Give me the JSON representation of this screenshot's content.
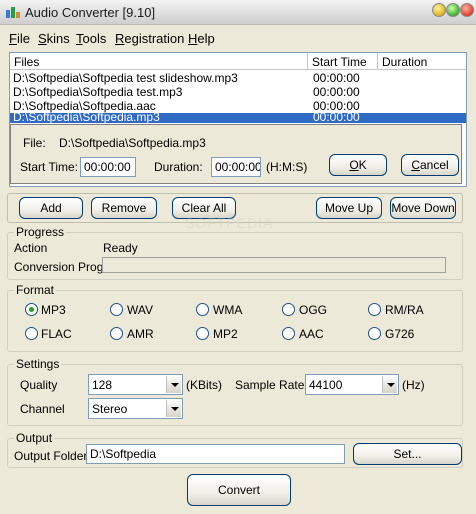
{
  "window": {
    "title": "Audio Converter [9.10]"
  },
  "menu": [
    {
      "accel": "F",
      "rest": "ile"
    },
    {
      "accel": "S",
      "rest": "kins"
    },
    {
      "accel": "T",
      "rest": "ools"
    },
    {
      "accel": "R",
      "rest": "egistration"
    },
    {
      "accel": "H",
      "rest": "elp"
    }
  ],
  "file_list": {
    "columns": [
      "Files",
      "Start Time",
      "Duration"
    ],
    "rows": [
      {
        "file": "D:\\Softpedia\\Softpedia test slideshow.mp3",
        "start": "00:00:00",
        "duration": ""
      },
      {
        "file": "D:\\Softpedia\\Softpedia test.mp3",
        "start": "00:00:00",
        "duration": ""
      },
      {
        "file": "D:\\Softpedia\\Softpedia.aac",
        "start": "00:00:00",
        "duration": ""
      },
      {
        "file": "D:\\Softpedia\\Softpedia.mp3",
        "start": "00:00:00",
        "duration": ""
      }
    ]
  },
  "editor": {
    "file_label": "File:",
    "file_value": "D:\\Softpedia\\Softpedia.mp3",
    "start_label": "Start Time:",
    "start_value": "00:00:00",
    "duration_label": "Duration:",
    "duration_value": "00:00:00",
    "hms_hint": "(H:M:S)",
    "ok_accel": "O",
    "ok_rest": "K",
    "cancel_accel": "C",
    "cancel_rest": "ancel"
  },
  "toolbar": {
    "add": "Add",
    "remove": "Remove",
    "clear_all": "Clear All",
    "move_up": "Move Up",
    "move_down": "Move Down"
  },
  "watermark": "SOFTPEDIA",
  "progress": {
    "title": "Progress",
    "action_label": "Action",
    "action_value": "Ready",
    "conversion_label": "Conversion Progr",
    "value_percent": 0
  },
  "format": {
    "title": "Format",
    "options": [
      "MP3",
      "WAV",
      "WMA",
      "OGG",
      "RM/RA",
      "FLAC",
      "AMR",
      "MP2",
      "AAC",
      "G726"
    ],
    "selected": "MP3"
  },
  "settings": {
    "title": "Settings",
    "quality_label": "Quality",
    "quality_value": "128",
    "quality_unit": "(KBits)",
    "sample_rate_label": "Sample Rate",
    "sample_rate_value": "44100",
    "sample_rate_unit": "(Hz)",
    "channel_label": "Channel",
    "channel_value": "Stereo"
  },
  "output": {
    "title": "Output",
    "folder_label": "Output Folder",
    "folder_value": "D:\\Softpedia",
    "set_button": "Set..."
  },
  "convert_button": "Convert"
}
